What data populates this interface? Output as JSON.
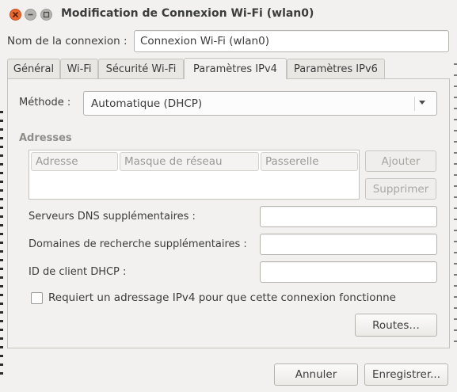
{
  "window": {
    "title": "Modification de Connexion Wi-Fi (wlan0)"
  },
  "connection_name": {
    "label": "Nom de la connexion :",
    "value": "Connexion Wi-Fi (wlan0)"
  },
  "tabs": [
    {
      "label": "Général"
    },
    {
      "label": "Wi-Fi"
    },
    {
      "label": "Sécurité Wi-Fi"
    },
    {
      "label": "Paramètres IPv4"
    },
    {
      "label": "Paramètres IPv6"
    }
  ],
  "ipv4": {
    "method_label": "Méthode :",
    "method_value": "Automatique (DHCP)",
    "addresses_heading": "Adresses",
    "columns": [
      "Adresse",
      "Masque de réseau",
      "Passerelle"
    ],
    "add_button": "Ajouter",
    "delete_button": "Supprimer",
    "dns_label": "Serveurs DNS supplémentaires :",
    "dns_value": "",
    "search_domains_label": "Domaines de recherche supplémentaires :",
    "search_domains_value": "",
    "dhcp_client_id_label": "ID de client DHCP :",
    "dhcp_client_id_value": "",
    "require_ipv4_label": "Requiert un adressage IPv4 pour que cette connexion fonctionne",
    "require_ipv4_checked": false,
    "routes_button": "Routes…"
  },
  "footer": {
    "cancel_button": "Annuler",
    "save_button": "Enregistrer..."
  }
}
